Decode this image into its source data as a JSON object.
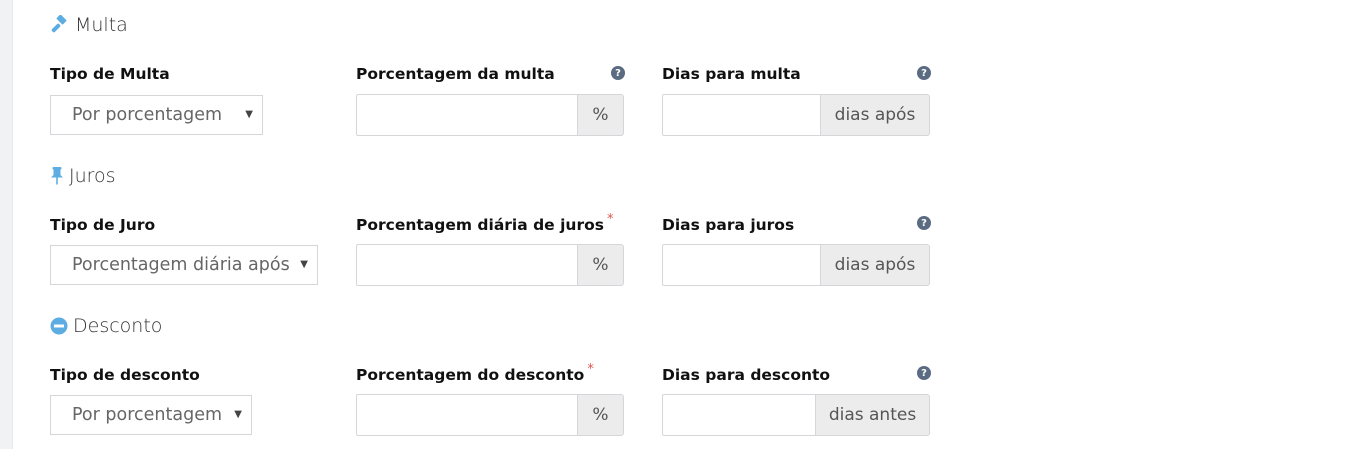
{
  "sections": {
    "multa": {
      "title": "Multa",
      "icon": "gavel-icon",
      "tipo_label": "Tipo de Multa",
      "tipo_value": "Por porcentagem",
      "porcentagem_label": "Porcentagem da multa",
      "porcentagem_addon": "%",
      "dias_label": "Dias para multa",
      "dias_addon": "dias após"
    },
    "juros": {
      "title": "Juros",
      "icon": "pushpin-icon",
      "tipo_label": "Tipo de Juro",
      "tipo_value": "Porcentagem diária após",
      "porcentagem_label": "Porcentagem diária de juros",
      "porcentagem_addon": "%",
      "dias_label": "Dias para juros",
      "dias_addon": "dias após"
    },
    "desconto": {
      "title": "Desconto",
      "icon": "minus-circle-icon",
      "tipo_label": "Tipo de desconto",
      "tipo_value": "Por porcentagem",
      "porcentagem_label": "Porcentagem do desconto",
      "porcentagem_addon": "%",
      "dias_label": "Dias para desconto",
      "dias_addon": "dias antes"
    }
  },
  "common": {
    "required_mark": "*",
    "help_glyph": "?",
    "caret": "▼"
  },
  "colors": {
    "icon_blue": "#5dade2",
    "help_icon": "#5b6b82",
    "required": "#e15353",
    "addon_bg": "#ececec",
    "border": "#d4d6da"
  }
}
